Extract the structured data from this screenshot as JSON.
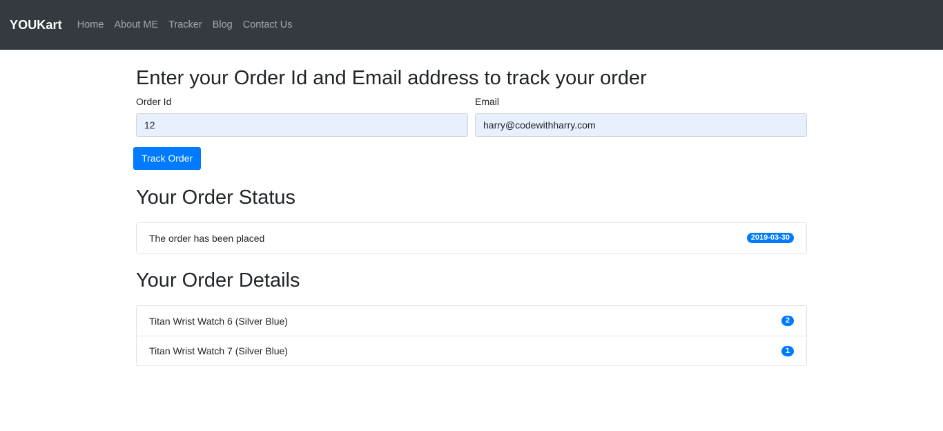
{
  "navbar": {
    "brand": "YOUKart",
    "links": [
      "Home",
      "About ME",
      "Tracker",
      "Blog",
      "Contact Us"
    ]
  },
  "tracker": {
    "heading": "Enter your Order Id and Email address to track your order",
    "order_id_label": "Order Id",
    "order_id_value": "12",
    "email_label": "Email",
    "email_value": "harry@codewithharry.com",
    "track_button": "Track Order"
  },
  "status": {
    "heading": "Your Order Status",
    "items": [
      {
        "text": "The order has been placed",
        "badge": "2019-03-30"
      }
    ]
  },
  "details": {
    "heading": "Your Order Details",
    "items": [
      {
        "name": "Titan Wrist Watch 6 (Silver Blue)",
        "qty": "2"
      },
      {
        "name": "Titan Wrist Watch 7 (Silver Blue)",
        "qty": "1"
      }
    ]
  },
  "colors": {
    "navbar_bg": "#343a40",
    "primary": "#007bff",
    "input_autofill_bg": "#e8f0fe"
  }
}
